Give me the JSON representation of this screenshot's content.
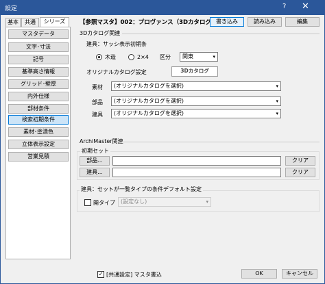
{
  "window": {
    "title": "設定",
    "help": "?",
    "close": "✕"
  },
  "tabs": [
    {
      "label": "基本"
    },
    {
      "label": "共通"
    },
    {
      "label": "シリーズ"
    }
  ],
  "nav": [
    {
      "label": "マスタデータ"
    },
    {
      "label": "文字･寸法"
    },
    {
      "label": "記号"
    },
    {
      "label": "基準高さ情報"
    },
    {
      "label": "グリッド･壁厚"
    },
    {
      "label": "内外仕様"
    },
    {
      "label": "部材条件"
    },
    {
      "label": "検索初期条件"
    },
    {
      "label": "素材･塗潰色"
    },
    {
      "label": "立体表示設定"
    },
    {
      "label": "営業見積"
    }
  ],
  "header": {
    "title": "【参照マスタ】002：プロヴァンス（3Dカタログ版）",
    "write_btn": "書き込み",
    "read_btn": "読み込み",
    "edit_btn": "編集"
  },
  "catalog3d": {
    "section": "3Dカタログ関連",
    "sash_label": "建具：サッシ表示初期条",
    "radio1": "木造",
    "radio2": "2×4",
    "kubun_label": "区分",
    "kubun_value": "関東",
    "original_label": "オリジナルカタログ設定",
    "logo_text": "3Dカタログ",
    "material_label": "素材",
    "material_value": "(オリジナルカタログを選択)",
    "parts_label": "部品",
    "parts_value": "(オリジナルカタログを選択)",
    "fitting_label": "建具",
    "fitting_value": "(オリジナルカタログを選択)"
  },
  "archimaster": {
    "section": "ArchiMaster関連",
    "init_label": "初期セット",
    "parts_btn": "部品...",
    "fitting_btn": "建具...",
    "clear1": "クリア",
    "clear2": "クリア",
    "default_label": "建具：セットが一覧タイプの条件デフォルト設定",
    "door_type_label": "開タイプ",
    "door_type_value": "(設定なし)"
  },
  "footer": {
    "checkbox_label": "[共通設定] マスタ書込",
    "ok": "OK",
    "cancel": "キャンセル"
  }
}
